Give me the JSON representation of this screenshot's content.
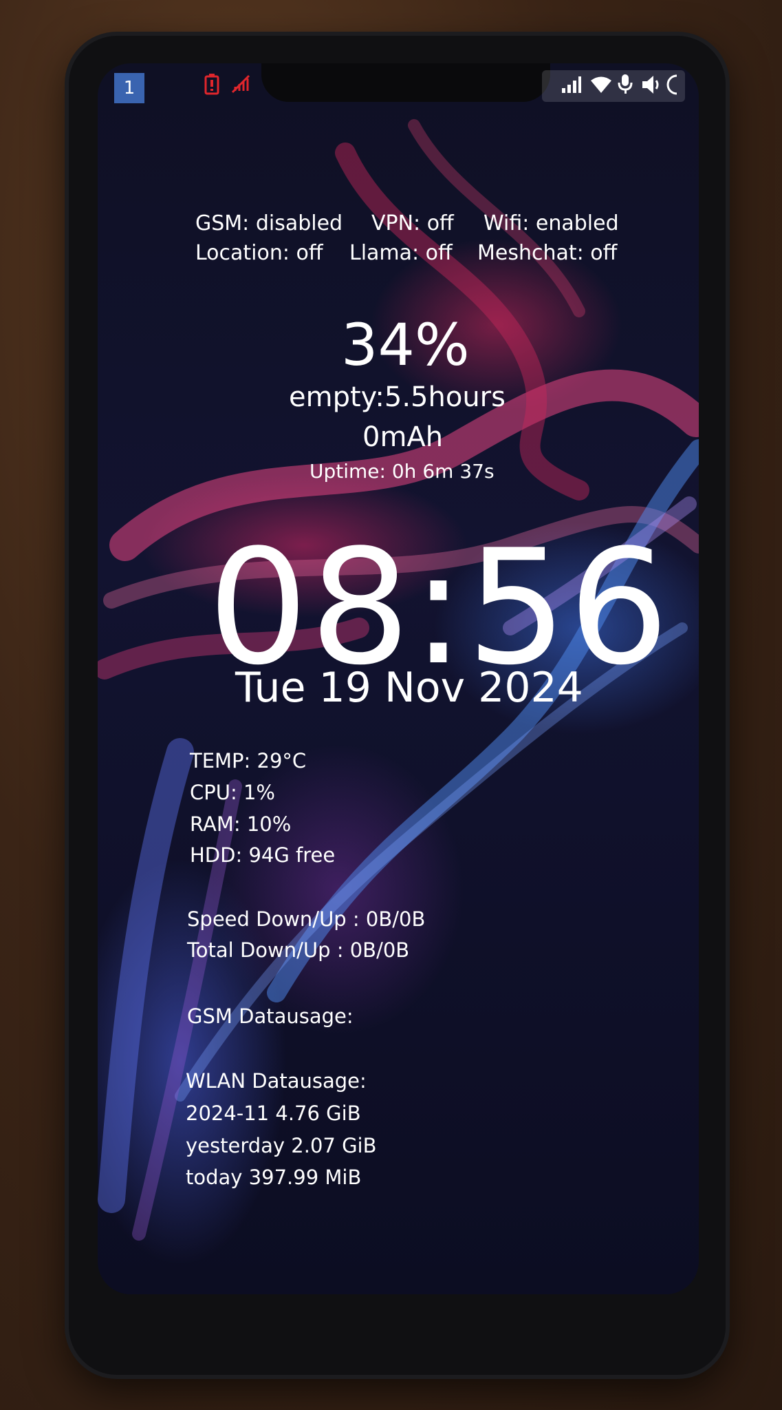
{
  "statusbar": {
    "workspace": "1",
    "icons": [
      "battery-alert-icon",
      "gsm-off-icon",
      "signal-icon",
      "wifi-icon",
      "mic-icon",
      "volume-icon",
      "moon-icon"
    ],
    "colors": {
      "alert": "#e0262c",
      "workspace": "#3a64b0"
    }
  },
  "services": {
    "gsm": "GSM: disabled",
    "vpn": "VPN: off",
    "wifi": "Wifi: enabled",
    "location": "Location: off",
    "llama": "Llama: off",
    "meshchat": "Meshchat: off"
  },
  "battery": {
    "percent": "34%",
    "empty": "empty:5.5hours",
    "current": "0mAh",
    "uptime": "Uptime: 0h 6m 37s"
  },
  "clock": {
    "time": "08:56",
    "date": "Tue 19 Nov 2024"
  },
  "system": {
    "temp": "TEMP: 29°C",
    "cpu": "CPU: 1%",
    "ram": "RAM: 10%",
    "hdd": "HDD: 94G free"
  },
  "network": {
    "speed": "Speed Down/Up : 0B/0B",
    "total": "Total Down/Up : 0B/0B"
  },
  "gsm_usage": {
    "title": "GSM Datausage:"
  },
  "wlan_usage": {
    "title": "WLAN Datausage:",
    "month": "2024-11 4.76 GiB",
    "yesterday": "yesterday 2.07 GiB",
    "today": "today 397.99 MiB"
  }
}
